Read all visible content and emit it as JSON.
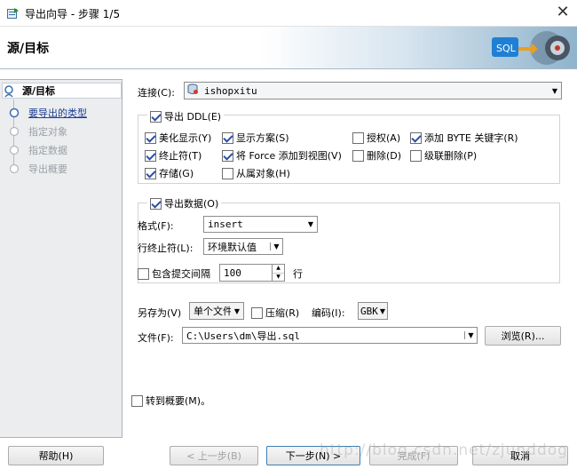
{
  "window": {
    "title": "导出向导 - 步骤 1/5",
    "close": "✕"
  },
  "banner": {
    "heading": "源/目标",
    "logo_text": "SQL"
  },
  "sidebar": {
    "steps": [
      {
        "label": "源/目标",
        "state": "active"
      },
      {
        "label": "要导出的类型",
        "state": "link"
      },
      {
        "label": "指定对象",
        "state": "disabled"
      },
      {
        "label": "指定数据",
        "state": "disabled"
      },
      {
        "label": "导出概要",
        "state": "disabled"
      }
    ]
  },
  "connection": {
    "label": "连接(C):",
    "value": "ishopxitu"
  },
  "ddl": {
    "label": "导出 DDL(E)",
    "checked": true,
    "options": [
      {
        "label": "美化显示(Y)",
        "checked": true
      },
      {
        "label": "显示方案(S)",
        "checked": true
      },
      {
        "label": "授权(A)",
        "checked": false
      },
      {
        "label": "添加 BYTE 关键字(R)",
        "checked": true
      },
      {
        "label": "终止符(T)",
        "checked": true
      },
      {
        "label": "将 Force 添加到视图(V)",
        "checked": true
      },
      {
        "label": "删除(D)",
        "checked": false
      },
      {
        "label": "级联删除(P)",
        "checked": false
      },
      {
        "label": "存储(G)",
        "checked": true
      },
      {
        "label": "从属对象(H)",
        "checked": false
      }
    ]
  },
  "data_export": {
    "label": "导出数据(O)",
    "checked": true,
    "format_label": "格式(F):",
    "format_value": "insert",
    "terminator_label": "行终止符(L):",
    "terminator_value": "环境默认值",
    "commit_label": "包含提交间隔",
    "commit_checked": false,
    "commit_value": "100",
    "rows_label": "行"
  },
  "save": {
    "save_as_label": "另存为(V)",
    "save_as_value": "单个文件",
    "compress_label": "压缩(R)",
    "compress_checked": false,
    "encoding_label": "编码(I):",
    "encoding_value": "GBK",
    "file_label": "文件(F):",
    "file_value": "C:\\Users\\dm\\导出.sql",
    "browse_label": "浏览(R)..."
  },
  "goto_summary": {
    "label": "转到概要(M)。",
    "checked": false
  },
  "buttons": {
    "help": "帮助(H)",
    "back": "< 上一步(B)",
    "next": "下一步(N) >",
    "finish": "完成(F)",
    "cancel": "取消"
  },
  "watermark": "http://blog.csdn.net/zjunddog"
}
